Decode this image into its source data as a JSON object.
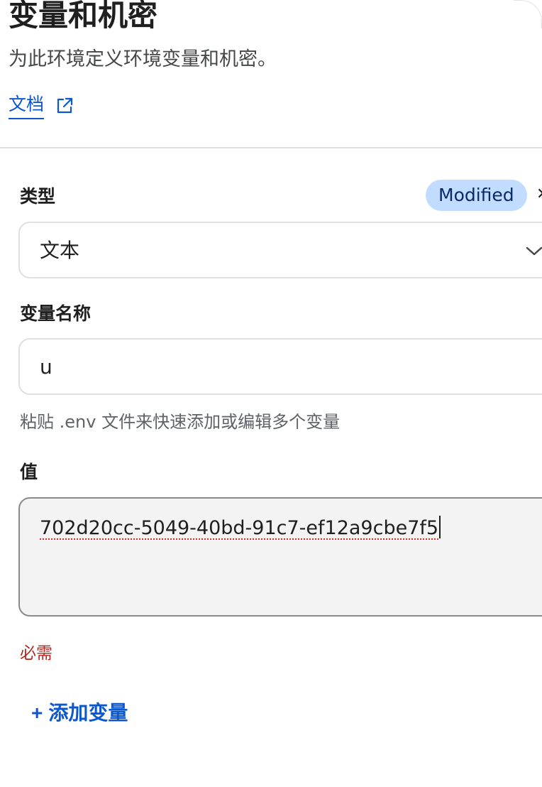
{
  "panel": {
    "title": "变量和机密",
    "subtitle": "为此环境定义环境变量和机密。",
    "docs_link": {
      "label": "文档",
      "icon": "external-link-icon"
    }
  },
  "form": {
    "type_field": {
      "label": "类型",
      "badge": "Modified",
      "value": "文本",
      "icon": "chevron-down-icon"
    },
    "name_field": {
      "label": "变量名称",
      "value": "u",
      "hint": "粘贴 .env 文件来快速添加或编辑多个变量"
    },
    "value_field": {
      "label": "值",
      "value": "702d20cc-5049-40bd-91c7-ef12a9cbe7f5",
      "error": "必需"
    },
    "add_button": {
      "plus": "+",
      "label": "添加变量"
    }
  },
  "colors": {
    "accent": "#0b57d0",
    "badge_bg": "#c2dcff",
    "error": "#b3261e"
  }
}
